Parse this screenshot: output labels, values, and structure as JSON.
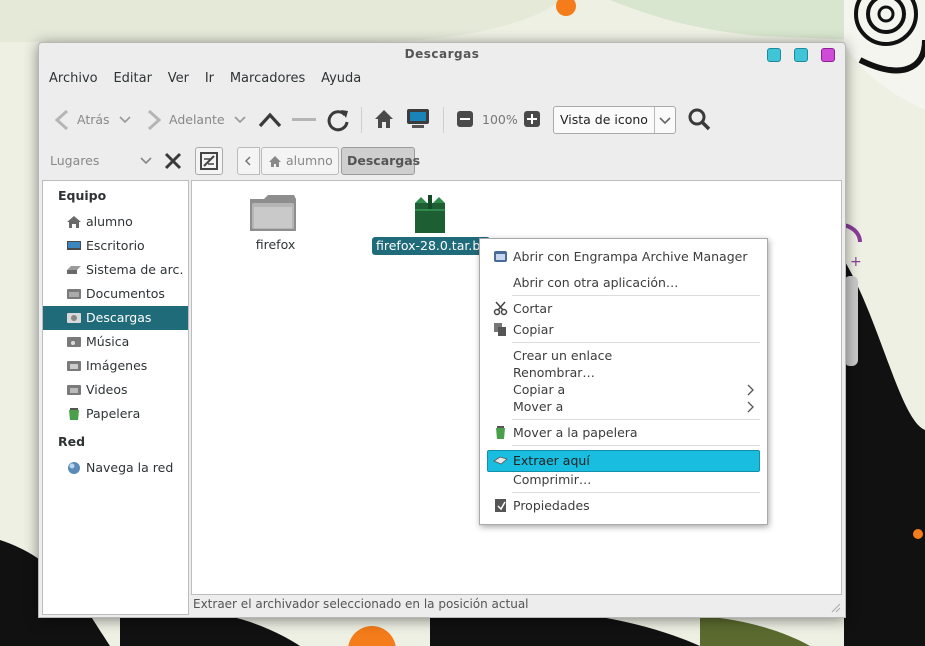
{
  "window": {
    "title": "Descargas"
  },
  "menubar": [
    {
      "label": "Archivo"
    },
    {
      "label": "Editar"
    },
    {
      "label": "Ver"
    },
    {
      "label": "Ir"
    },
    {
      "label": "Marcadores"
    },
    {
      "label": "Ayuda"
    }
  ],
  "toolbar": {
    "back_label": "Atrás",
    "forward_label": "Adelante",
    "zoom": "100%",
    "view_mode": "Vista de icono"
  },
  "location": {
    "places_label": "Lugares",
    "crumbs": [
      "alumno",
      "Descargas"
    ]
  },
  "sidebar": {
    "section_computer": "Equipo",
    "items": [
      {
        "label": "alumno",
        "icon": "home-icon"
      },
      {
        "label": "Escritorio",
        "icon": "desktop-icon"
      },
      {
        "label": "Sistema de arc…",
        "icon": "drive-icon"
      },
      {
        "label": "Documentos",
        "icon": "folder-icon"
      },
      {
        "label": "Descargas",
        "icon": "download-folder-icon",
        "selected": true
      },
      {
        "label": "Música",
        "icon": "music-folder-icon"
      },
      {
        "label": "Imágenes",
        "icon": "pictures-folder-icon"
      },
      {
        "label": "Videos",
        "icon": "videos-folder-icon"
      },
      {
        "label": "Papelera",
        "icon": "trash-icon"
      }
    ],
    "section_network": "Red",
    "network_items": [
      {
        "label": "Navega la red",
        "icon": "network-icon"
      }
    ]
  },
  "files": [
    {
      "name": "firefox",
      "type": "folder"
    },
    {
      "name": "firefox-28.0.tar.bz2",
      "type": "archive",
      "selected": true
    }
  ],
  "context_menu": {
    "items": [
      {
        "label": "Abrir con Engrampa Archive Manager",
        "icon": "archive-manager-icon"
      },
      {
        "label": "Abrir con otra aplicación…"
      },
      {
        "label": "Cortar",
        "icon": "scissors-icon"
      },
      {
        "label": "Copiar",
        "icon": "copy-icon"
      },
      {
        "label": "Crear un enlace"
      },
      {
        "label": "Renombrar…"
      },
      {
        "label": "Copiar a"
      },
      {
        "label": "Mover a"
      },
      {
        "label": "Mover a la papelera",
        "icon": "trash-icon"
      },
      {
        "label": "Extraer aquí",
        "icon": "extract-icon",
        "highlighted": true
      },
      {
        "label": "Comprimir…"
      },
      {
        "label": "Propiedades",
        "icon": "properties-icon"
      }
    ]
  },
  "statusbar": {
    "text": "Extraer el archivador seleccionado en la posición actual"
  },
  "colors": {
    "selection": "#206b7a",
    "menu_highlight": "#19bde0"
  }
}
